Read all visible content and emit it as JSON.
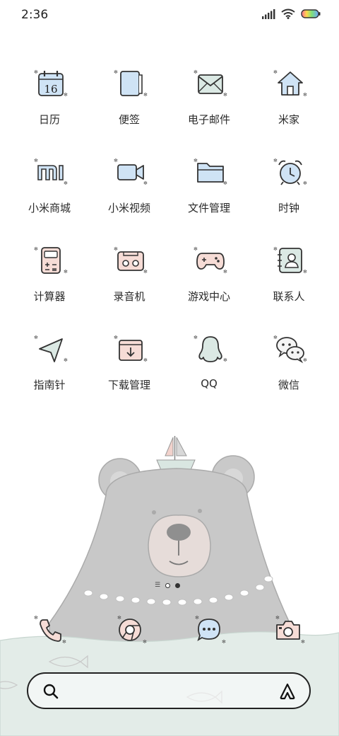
{
  "status_bar": {
    "time": "2:36",
    "icons": [
      "signal-icon",
      "wifi-icon",
      "battery-icon"
    ]
  },
  "apps": [
    {
      "label": "日历",
      "icon": "calendar-icon",
      "calendar_day": "16"
    },
    {
      "label": "便签",
      "icon": "notes-icon"
    },
    {
      "label": "电子邮件",
      "icon": "email-icon"
    },
    {
      "label": "米家",
      "icon": "home-icon"
    },
    {
      "label": "小米商城",
      "icon": "mi-store-icon"
    },
    {
      "label": "小米视频",
      "icon": "video-icon"
    },
    {
      "label": "文件管理",
      "icon": "folder-icon"
    },
    {
      "label": "时钟",
      "icon": "alarm-clock-icon"
    },
    {
      "label": "计算器",
      "icon": "calculator-icon"
    },
    {
      "label": "录音机",
      "icon": "recorder-icon"
    },
    {
      "label": "游戏中心",
      "icon": "gamepad-icon"
    },
    {
      "label": "联系人",
      "icon": "contacts-icon"
    },
    {
      "label": "指南针",
      "icon": "compass-icon"
    },
    {
      "label": "下载管理",
      "icon": "download-icon"
    },
    {
      "label": "QQ",
      "icon": "qq-penguin-icon"
    },
    {
      "label": "微信",
      "icon": "wechat-icon"
    }
  ],
  "page_indicator": {
    "pages": 2,
    "current": 2
  },
  "dock": [
    {
      "icon": "phone-icon"
    },
    {
      "icon": "browser-icon"
    },
    {
      "icon": "messages-icon"
    },
    {
      "icon": "camera-icon"
    }
  ],
  "search_bar": {
    "left_icon": "search-icon",
    "right_icon": "assistant-icon"
  },
  "colors": {
    "icon_fill_blue": "#cfe3f5",
    "icon_fill_pink": "#f6dcd6",
    "icon_stroke": "#333333",
    "bear_gray": "#c8c8c8",
    "water": "#e3ece8"
  }
}
